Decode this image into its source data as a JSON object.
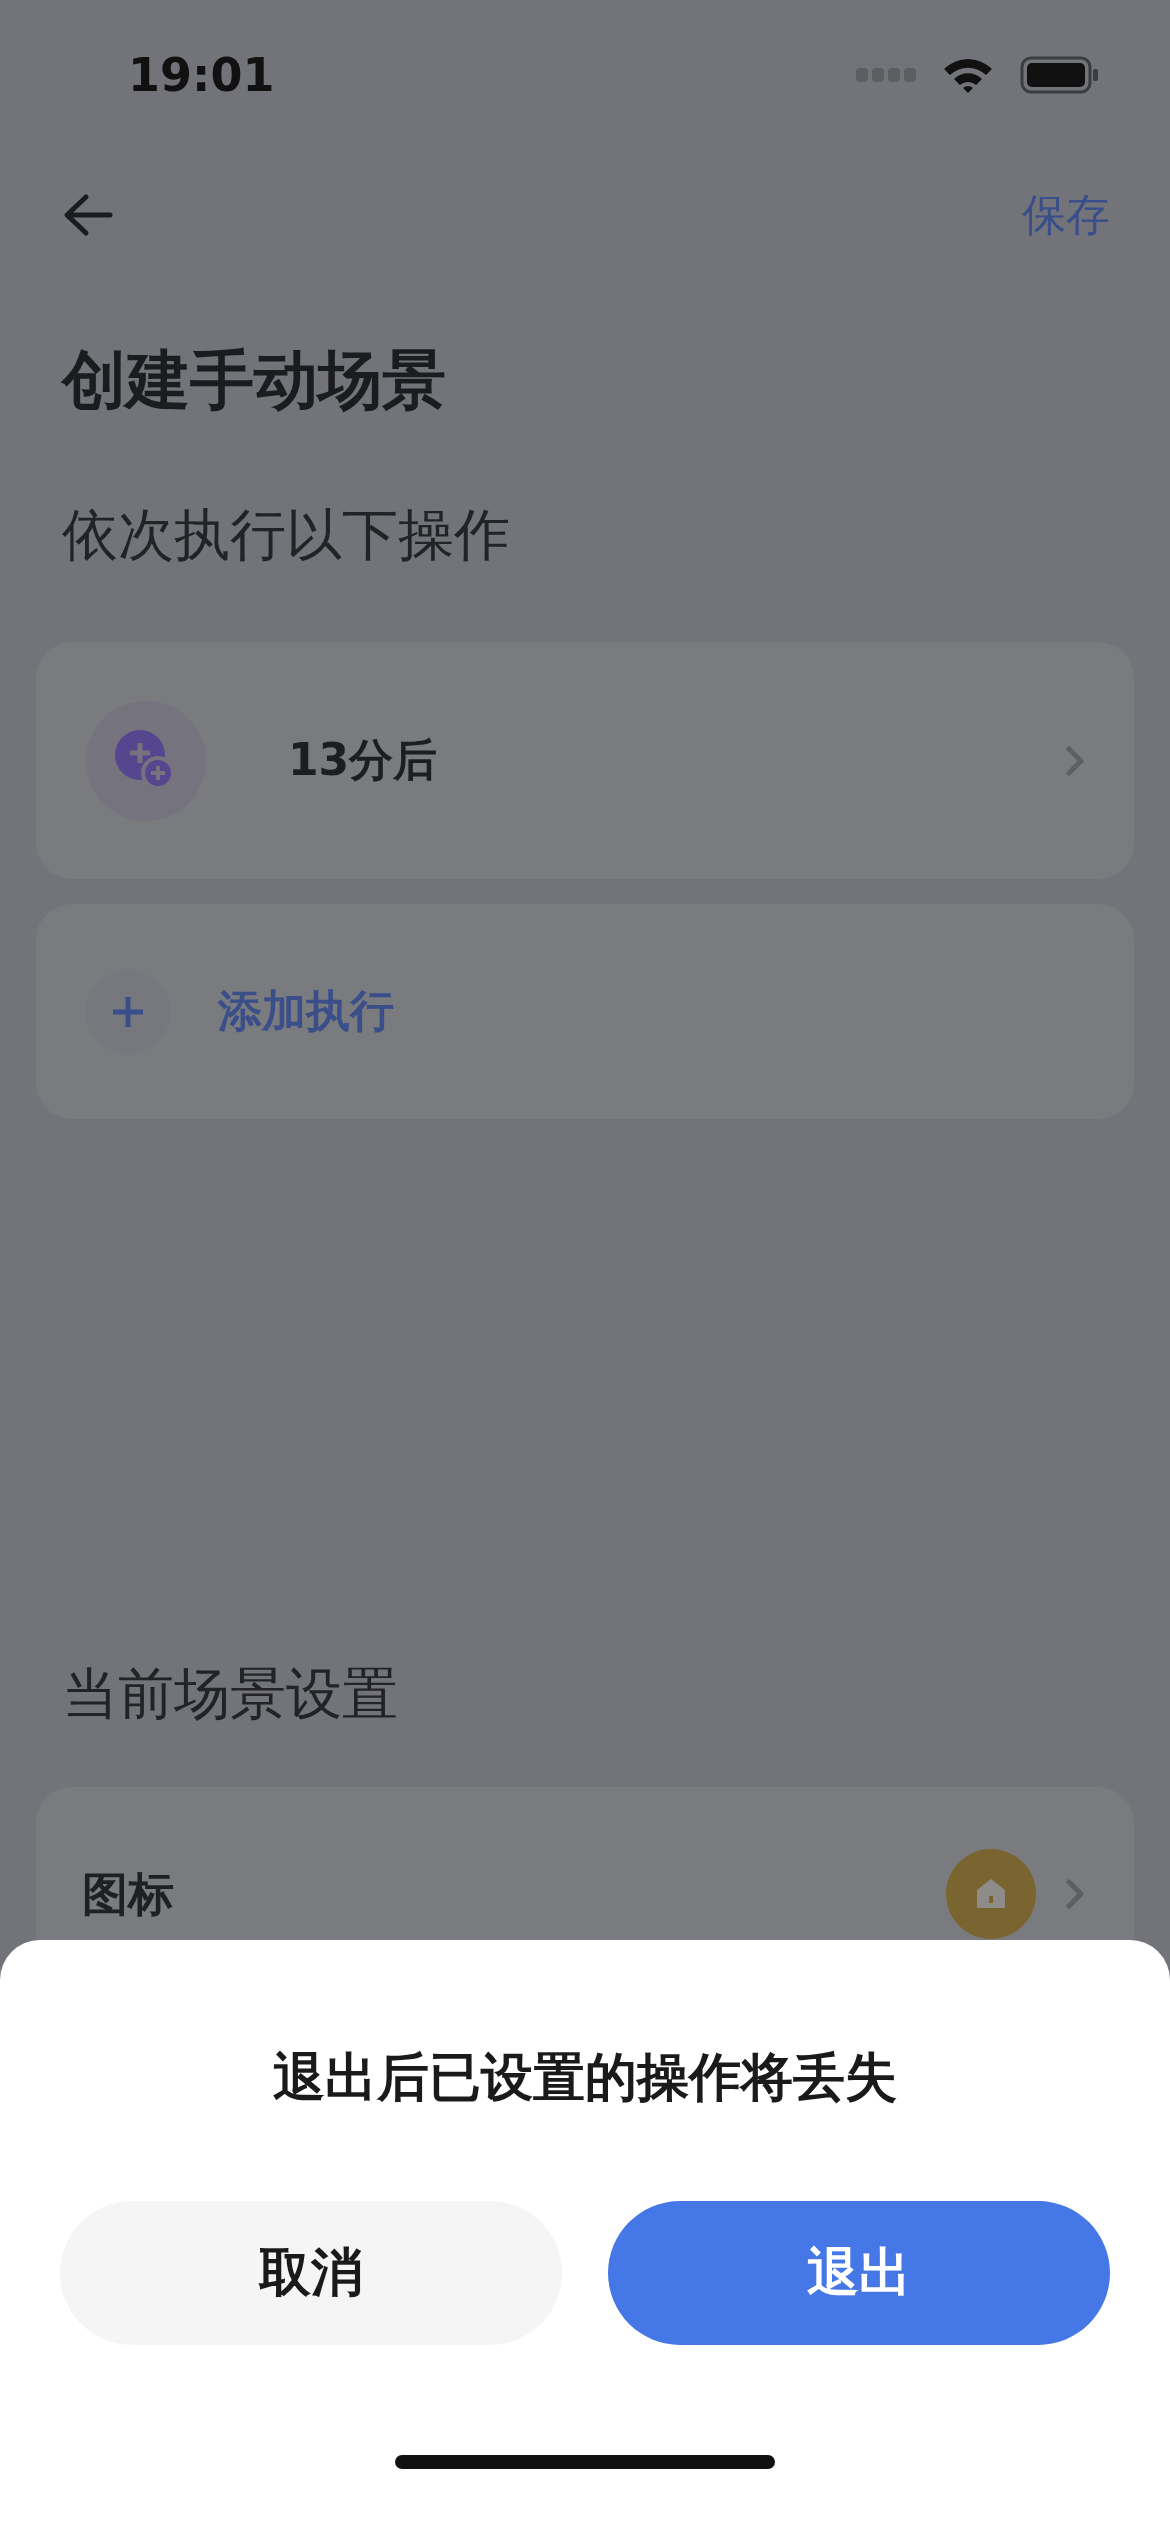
{
  "status_bar": {
    "time": "19:01"
  },
  "nav": {
    "save": "保存"
  },
  "title": "创建手动场景",
  "actions_heading": "依次执行以下操作",
  "actions": [
    {
      "kind": "delay",
      "label": "13分后"
    },
    {
      "kind": "add",
      "label": "添加执行"
    }
  ],
  "settings_heading": "当前场景设置",
  "settings": [
    {
      "label": "图标"
    }
  ],
  "dialog": {
    "message": "退出后已设置的操作将丢失",
    "buttons": [
      {
        "kind": "secondary",
        "label": "取消"
      },
      {
        "kind": "primary",
        "label": "退出"
      }
    ]
  }
}
